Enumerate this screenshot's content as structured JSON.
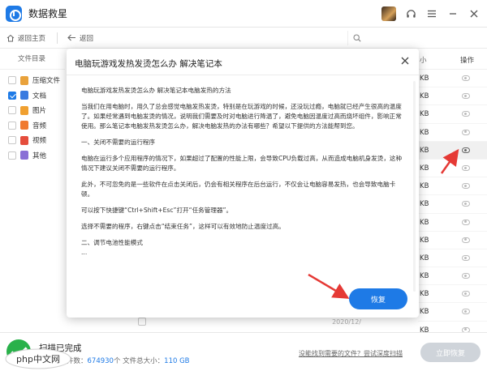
{
  "app": {
    "title": "数据救星"
  },
  "toolbar": {
    "home_label": "返回主页",
    "back_label": "返回"
  },
  "sidebar": {
    "header": "文件目录",
    "items": [
      {
        "label": "压缩文件",
        "checked": false,
        "color": "#e9a23b"
      },
      {
        "label": "文档",
        "checked": true,
        "color": "#3a7be0"
      },
      {
        "label": "图片",
        "checked": false,
        "color": "#f0a030"
      },
      {
        "label": "音频",
        "checked": false,
        "color": "#f07a30"
      },
      {
        "label": "视频",
        "checked": false,
        "color": "#e54d3c"
      },
      {
        "label": "其他",
        "checked": false,
        "color": "#8a6fd6"
      }
    ]
  },
  "rightcol": {
    "size_header": "小",
    "op_header": "操作",
    "rows": [
      {
        "size": "KB"
      },
      {
        "size": "KB"
      },
      {
        "size": "KB"
      },
      {
        "size": "KB"
      },
      {
        "size": "KB"
      },
      {
        "size": "KB"
      },
      {
        "size": "KB"
      },
      {
        "size": "KB"
      },
      {
        "size": "KB"
      },
      {
        "size": "KB"
      },
      {
        "size": "KB"
      },
      {
        "size": "KB"
      },
      {
        "size": "KB"
      },
      {
        "size": "KB"
      },
      {
        "size": "KB"
      }
    ]
  },
  "modal": {
    "title": "电脑玩游戏发热发烫怎么办 解决笔记本",
    "paragraphs": [
      "电脑玩游戏发热发烫怎么办 解决笔记本电脑发热的方法",
      "当我们在用电脑时，用久了总会感觉电脑发热发烫，特别是在玩游戏的时候，还没玩过瘾，电脑就已经产生很高的温度了。如果经常遇到电脑发烫的情况，说明我们需要及时对电脑进行降温了，避免电脑因温度过高而烧坏组件，影响正常使用。那么笔记本电脑发热发烫怎么办，解决电脑发热的办法有哪些？希望以下提供的方法能帮到您。",
      "一、关闭不需要的运行程序",
      "电脑在运行多个应用程序的情况下，如果超过了配置的性能上限，会导致CPU负载过高，从而造成电脑机身发烫，这种情况下建议关闭不需要的运行程序。",
      "此外，不可忽免的是一些软件在点击关闭后，仍会有相关程序在后台运行，不仅会让电脑容易发热，也会导致电脑卡顿。",
      "可以按下快捷键“Ctrl+Shift+Esc”打开“任务管理器”。",
      "选择不需要的程序，右键点击“结束任务”，这样可以有效地防止温度过高。",
      "二、调节电池性能模式",
      "..."
    ],
    "restore_label": "恢复"
  },
  "bottom_row": {
    "date": "2020/12/"
  },
  "footer": {
    "status": "扫描已完成",
    "found_prefix": "已找到文件数：",
    "found_count": "674930",
    "size_prefix": "个 文件总大小：",
    "size_value": "110 GB",
    "deep_link": "没能找到需要的文件？尝试深度扫描",
    "recover_label": "立即恢复"
  },
  "watermark": {
    "text": "php中文网"
  },
  "colors": {
    "accent": "#1e7ae6",
    "success": "#29b14a",
    "arrow": "#e53935"
  }
}
